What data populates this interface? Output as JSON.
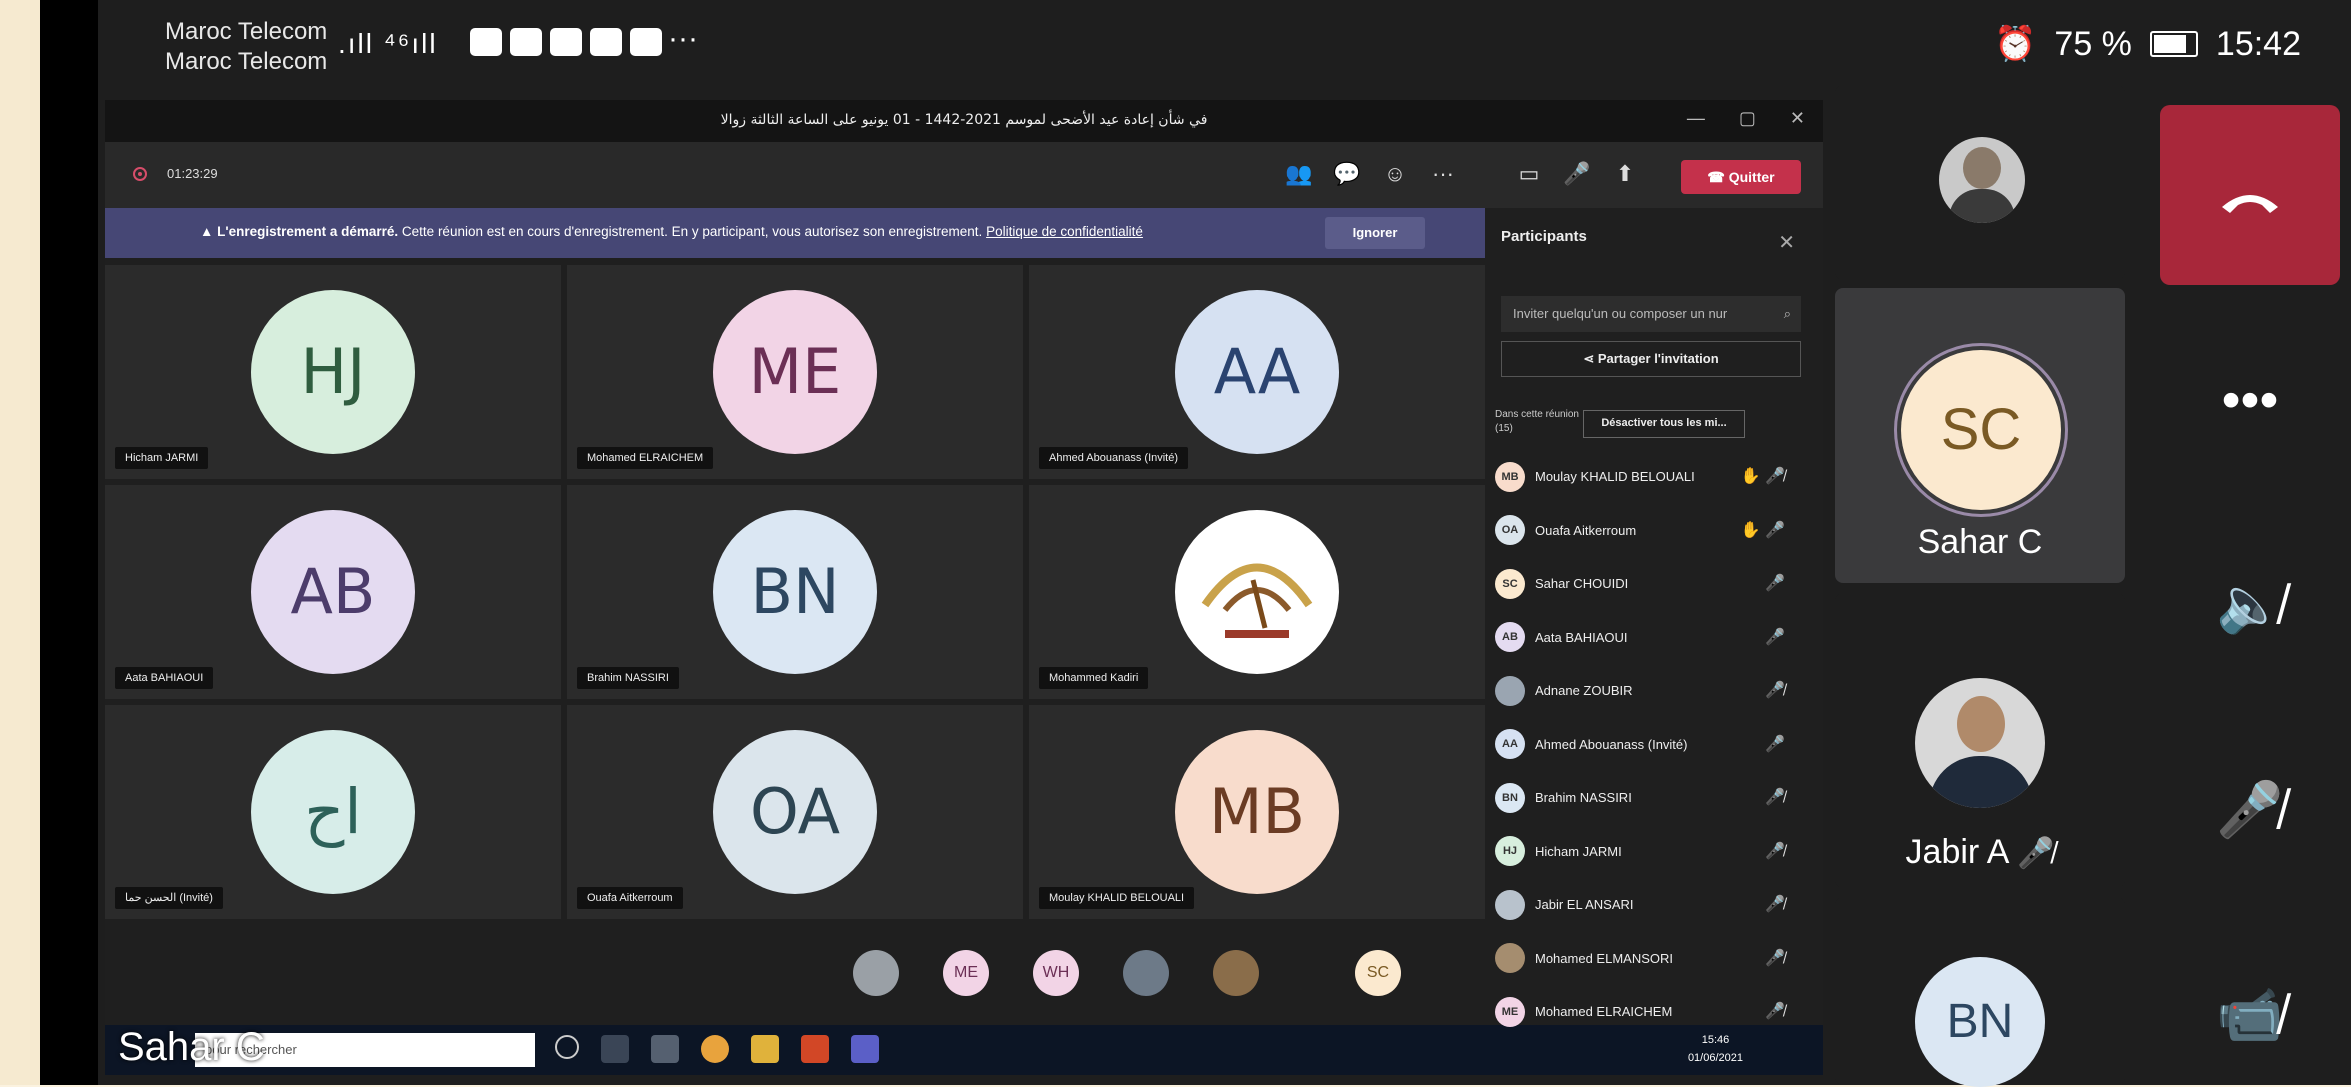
{
  "status_bar": {
    "carrier_1": "Maroc Telecom",
    "carrier_2": "Maroc Telecom",
    "signal": ".ıll ⁴⁶ıll",
    "dots": "···",
    "alarm": "⏰",
    "battery_percent": "75 %",
    "time": "15:42"
  },
  "teams_window": {
    "title": "في شأن إعادة عيد الأضحى لموسم 2021-1442 - 01 يونيو على الساعة الثالثة زوالا",
    "controls": [
      "—",
      "▢",
      "✕"
    ],
    "recording_time": "01:23:29",
    "toolbar_icons": [
      "participants-icon",
      "chat-icon",
      "reactions-icon",
      "more-icon",
      "camera-icon",
      "mic-icon",
      "share-icon"
    ],
    "quit_label": "Quitter",
    "banner": {
      "bold": "L'enregistrement a démarré.",
      "text": "Cette réunion est en cours d'enregistrement. En y participant, vous autorisez son enregistrement.",
      "link": "Politique de confidentialité",
      "ignore": "Ignorer"
    },
    "tiles": [
      {
        "initials": "HJ",
        "name": "Hicham JARMI",
        "bg": "#d7eedd",
        "fg": "#2f5d3f"
      },
      {
        "initials": "ME",
        "name": "Mohamed ELRAICHEM",
        "bg": "#f2d4e6",
        "fg": "#6b2f55"
      },
      {
        "initials": "AA",
        "name": "Ahmed Abouanass (Invité)",
        "bg": "#d6e1f2",
        "fg": "#2a4370"
      },
      {
        "initials": "AB",
        "name": "Aata BAHIAOUI",
        "bg": "#e4dbf1",
        "fg": "#4c3c6b"
      },
      {
        "initials": "BN",
        "name": "Brahim NASSIRI",
        "bg": "#dbe7f3",
        "fg": "#2d4761"
      },
      {
        "initials": "",
        "name": "Mohammed Kadiri",
        "bg": "#ffffff",
        "fg": "#7a5a24"
      },
      {
        "initials": "اح",
        "name": "الحسن حما (Invité)",
        "bg": "#d7ede9",
        "fg": "#2d6159"
      },
      {
        "initials": "OA",
        "name": "Ouafa Aitkerroum",
        "bg": "#dbe5ec",
        "fg": "#2d4553"
      },
      {
        "initials": "MB",
        "name": "Moulay KHALID BELOUALI",
        "bg": "#f8dccc",
        "fg": "#6b3c24"
      }
    ],
    "mini_avatars": [
      "",
      "ME",
      "WH",
      "",
      "",
      "SC"
    ],
    "taskbar": {
      "search_placeholder": "pour rechercher",
      "clock_time": "15:46",
      "clock_date": "01/06/2021"
    }
  },
  "participants_panel": {
    "title": "Participants",
    "invite_placeholder": "Inviter quelqu'un ou composer un nur",
    "share_label": "Partager l'invitation",
    "section_label": "Dans cette réunion",
    "section_count": "(15)",
    "mute_all": "Désactiver tous les mi...",
    "people": [
      {
        "initials": "MB",
        "name": "Moulay KHALID BELOUALI",
        "bg": "#f8dccc",
        "status": "✋ 🎤̸"
      },
      {
        "initials": "OA",
        "name": "Ouafa Aitkerroum",
        "bg": "#dbe5ec",
        "status": "✋ 🎤"
      },
      {
        "initials": "SC",
        "name": "Sahar CHOUIDI",
        "bg": "#fbe9cf",
        "status": "🎤"
      },
      {
        "initials": "AB",
        "name": "Aata BAHIAOUI",
        "bg": "#e4dbf1",
        "status": "🎤"
      },
      {
        "initials": "",
        "name": "Adnane ZOUBIR",
        "bg": "#9aa5b1",
        "status": "🎤̸"
      },
      {
        "initials": "AA",
        "name": "Ahmed Abouanass (Invité)",
        "bg": "#d6e1f2",
        "status": "🎤"
      },
      {
        "initials": "BN",
        "name": "Brahim NASSIRI",
        "bg": "#dbe7f3",
        "status": "🎤̸"
      },
      {
        "initials": "HJ",
        "name": "Hicham JARMI",
        "bg": "#d7eedd",
        "status": "🎤̸"
      },
      {
        "initials": "",
        "name": "Jabir EL ANSARI",
        "bg": "#b8c2cc",
        "status": "🎤̸"
      },
      {
        "initials": "",
        "name": "Mohamed ELMANSORI",
        "bg": "#a58d6f",
        "status": "🎤̸"
      },
      {
        "initials": "ME",
        "name": "Mohamed ELRAICHEM",
        "bg": "#f2d4e6",
        "status": "🎤̸"
      }
    ]
  },
  "phone_sidebar": {
    "sahar_initials": "SC",
    "sahar_name": "Sahar C",
    "jabir_name": "Jabir A",
    "bn_initials": "BN",
    "overlay_name": "Sahar C"
  },
  "colors": {
    "hangup": "#a8273a",
    "quit": "#c4314b",
    "banner": "#464775"
  }
}
